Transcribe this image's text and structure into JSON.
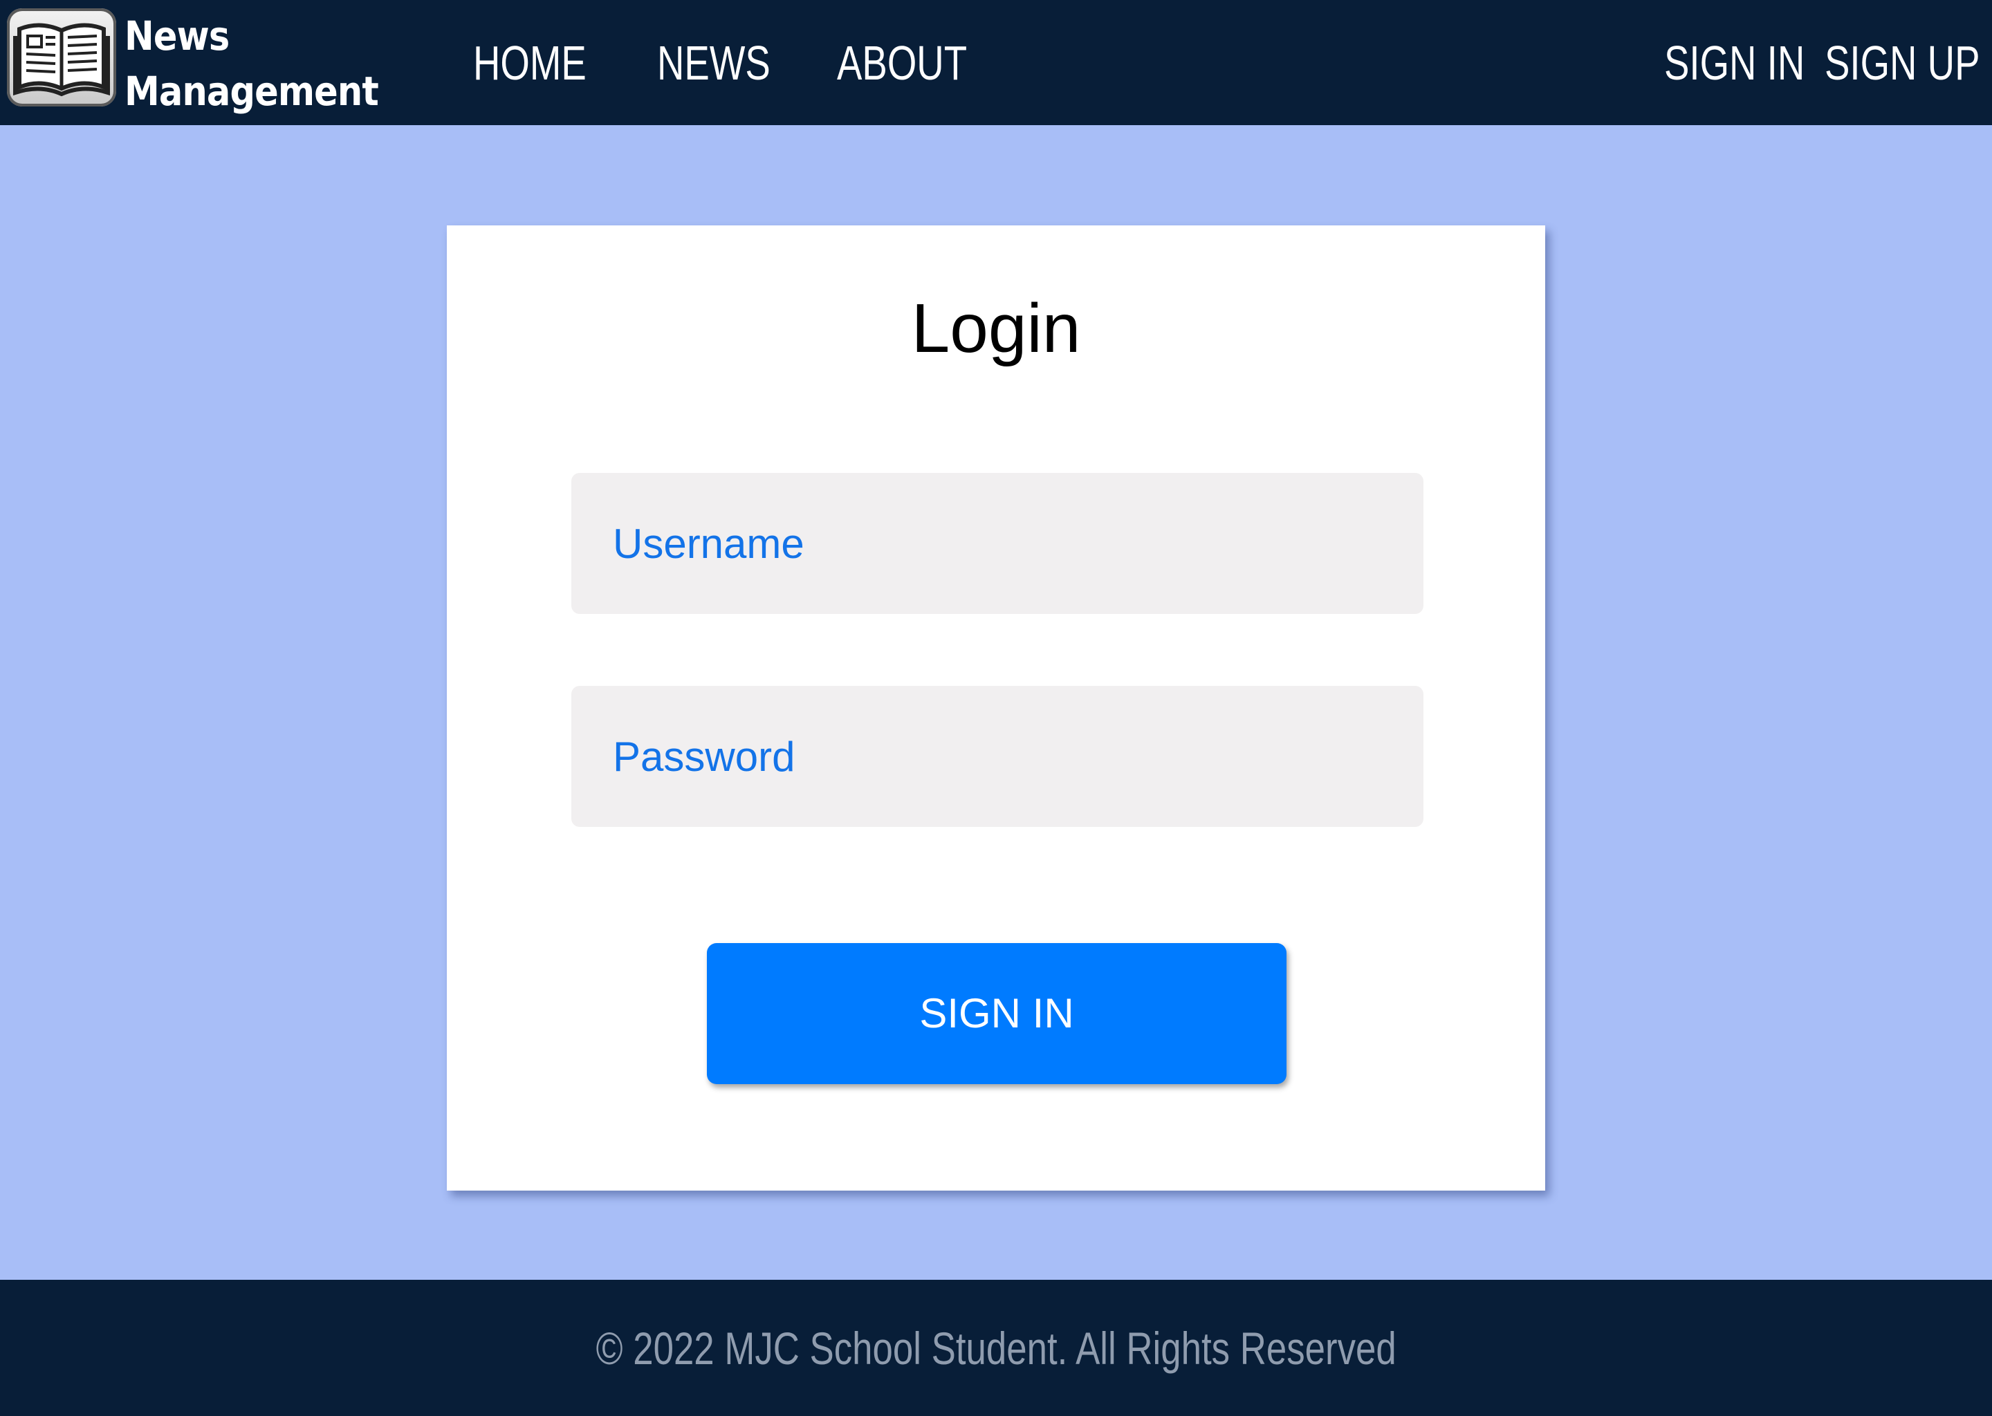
{
  "header": {
    "brand_line1": "News",
    "brand_line2": "Management",
    "logo_icon": "newspaper-icon",
    "nav": [
      {
        "label": "HOME"
      },
      {
        "label": "NEWS"
      },
      {
        "label": "ABOUT"
      }
    ],
    "auth": [
      {
        "label": "SIGN IN"
      },
      {
        "label": "SIGN UP"
      }
    ]
  },
  "login": {
    "title": "Login",
    "username_placeholder": "Username",
    "username_value": "",
    "password_placeholder": "Password",
    "password_value": "",
    "submit_label": "SIGN IN"
  },
  "footer": {
    "text": "©  2022  MJC School Student. All Rights Reserved"
  },
  "colors": {
    "header_bg": "#081e38",
    "page_bg": "#a8bef7",
    "accent": "#007bff",
    "placeholder": "#1373e8",
    "field_bg": "#f1eff0"
  }
}
